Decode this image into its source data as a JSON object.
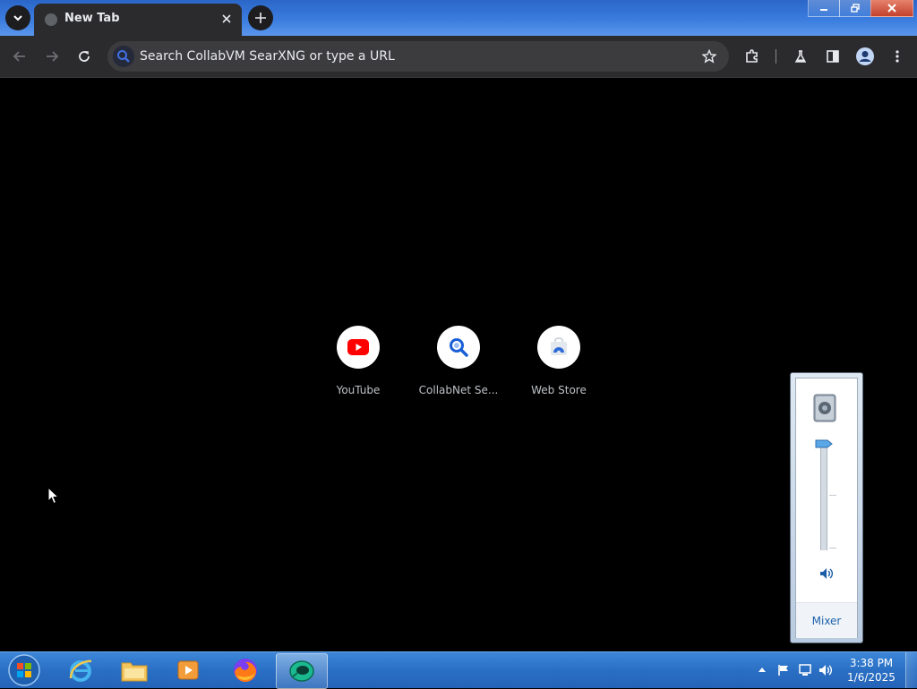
{
  "browser": {
    "tab": {
      "title": "New Tab"
    },
    "omnibox": {
      "placeholder": "Search CollabVM SearXNG or type a URL"
    }
  },
  "shortcuts": [
    {
      "label": "YouTube",
      "icon": "youtube-icon"
    },
    {
      "label": "CollabNet Se...",
      "icon": "search-icon"
    },
    {
      "label": "Web Store",
      "icon": "web-store-icon"
    }
  ],
  "volume_flyout": {
    "mixer_label": "Mixer",
    "level_percent": 100
  },
  "taskbar": {
    "apps": [
      "internet-explorer",
      "file-explorer",
      "media-player",
      "firefox",
      "collabvm-browser"
    ],
    "clock": {
      "time": "3:38 PM",
      "date": "1/6/2025"
    }
  },
  "colors": {
    "tab_strip": "#2a66c8",
    "toolbar": "#2b2b2e",
    "content_bg": "#000000",
    "youtube_red": "#ff0000",
    "search_blue": "#1a5fd6"
  }
}
